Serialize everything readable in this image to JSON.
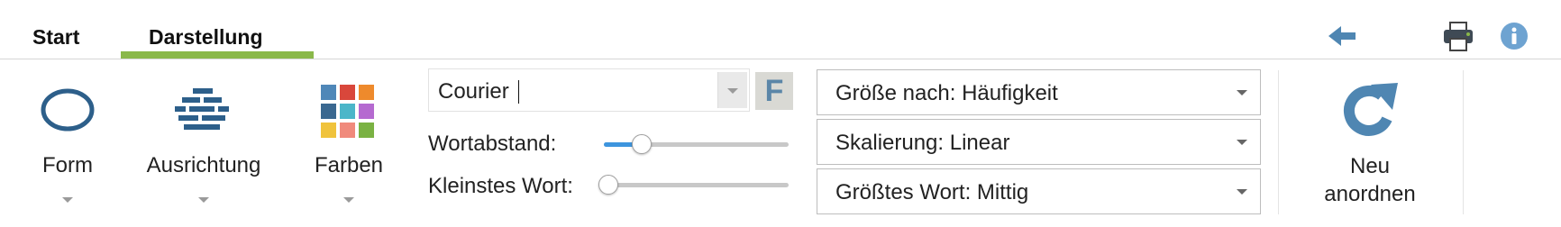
{
  "tabs": [
    {
      "label": "Start",
      "active": false
    },
    {
      "label": "Darstellung",
      "active": true
    }
  ],
  "toolbar_icons": [
    {
      "name": "back-arrow-icon"
    },
    {
      "name": "printer-icon"
    },
    {
      "name": "info-icon"
    }
  ],
  "form": {
    "label": "Form",
    "icon": "ellipse-icon"
  },
  "ausrichtung": {
    "label": "Ausrichtung",
    "icon": "brick-lines-icon"
  },
  "farben": {
    "label": "Farben",
    "icon": "color-grid-icon",
    "swatches": [
      "#4f87b8",
      "#d9473b",
      "#ee8a2c",
      "#3a6890",
      "#4bb6c9",
      "#b56ad0",
      "#f0c33c",
      "#f08a7c",
      "#7ab243"
    ]
  },
  "font": {
    "value": "Courier",
    "bold_button": "F"
  },
  "wortabstand": {
    "label": "Wortabstand:",
    "value": 0.2
  },
  "kleinstes_wort": {
    "label": "Kleinstes Wort:",
    "value": 0.02
  },
  "dropdowns": {
    "groesse": "Größe nach: Häufigkeit",
    "skalierung": "Skalierung: Linear",
    "groesstes": "Größtes Wort: Mittig"
  },
  "neu_anordnen": {
    "line1": "Neu",
    "line2": "anordnen",
    "icon": "refresh-icon"
  },
  "colors": {
    "accent_underline": "#8ab84a",
    "icon_blue": "#4f86b2",
    "slider_fill": "#3d95de"
  }
}
